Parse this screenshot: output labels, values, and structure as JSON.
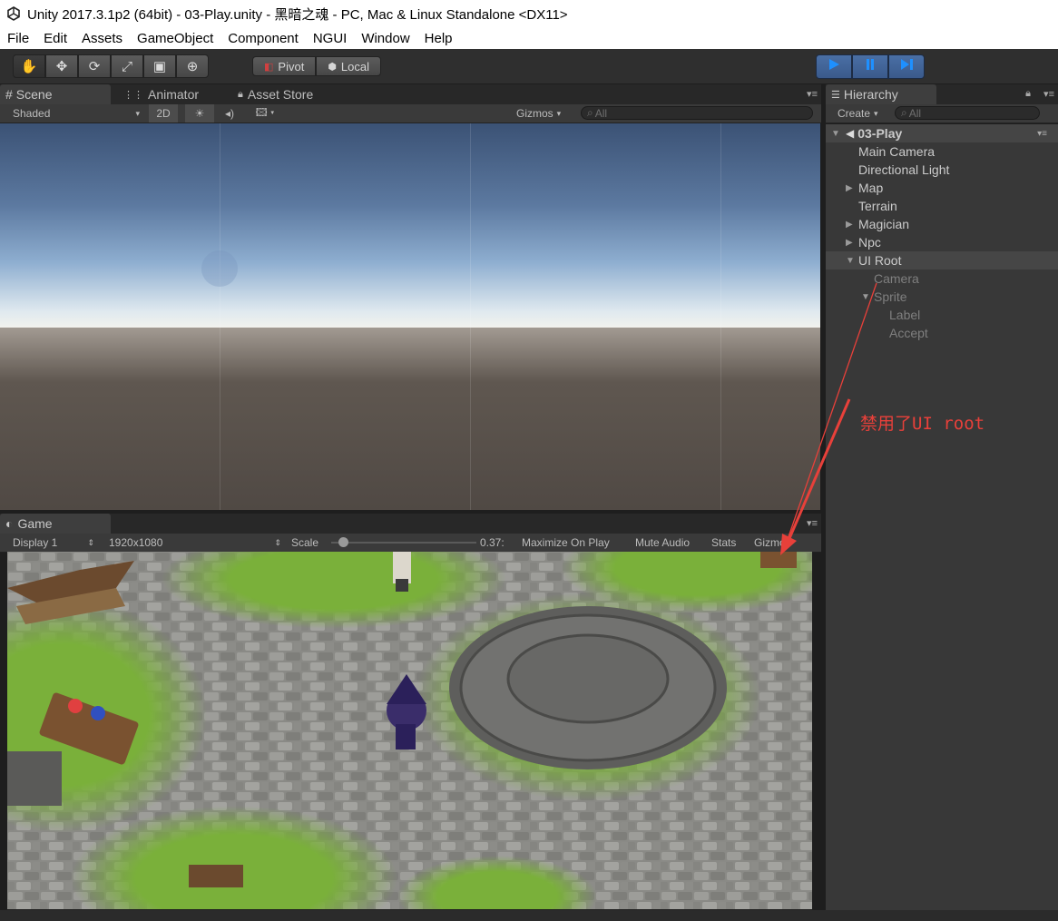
{
  "window": {
    "title": "Unity 2017.3.1p2 (64bit) - 03-Play.unity - 黑暗之魂 - PC, Mac & Linux Standalone <DX11>"
  },
  "menu": [
    "File",
    "Edit",
    "Assets",
    "GameObject",
    "Component",
    "NGUI",
    "Window",
    "Help"
  ],
  "toolbar": {
    "transform_tools": [
      "hand-icon",
      "move-icon",
      "rotate-icon",
      "scale-icon",
      "rect-icon",
      "transform-icon"
    ],
    "pivot_label": "Pivot",
    "local_label": "Local",
    "play_controls": [
      "play-icon",
      "pause-icon",
      "step-icon"
    ],
    "accent": "#1e90ff"
  },
  "scene_panel": {
    "tabs": [
      "Scene",
      "Animator",
      "Asset Store"
    ],
    "shading_mode": "Shaded",
    "mode_2d": "2D",
    "gizmos": "Gizmos",
    "search_placeholder": "All"
  },
  "game_panel": {
    "tab": "Game",
    "display": "Display 1",
    "resolution": "1920x1080",
    "scale_label": "Scale",
    "scale_value": "0.37:",
    "maximize": "Maximize On Play",
    "mute": "Mute Audio",
    "stats": "Stats",
    "gizmos": "Gizmos"
  },
  "hierarchy": {
    "tab": "Hierarchy",
    "create": "Create",
    "search_placeholder": "All",
    "scene_name": "03-Play",
    "items": [
      {
        "label": "Main Camera",
        "depth": 1,
        "arrow": "",
        "state": "normal"
      },
      {
        "label": "Directional Light",
        "depth": 1,
        "arrow": "",
        "state": "normal"
      },
      {
        "label": "Map",
        "depth": 1,
        "arrow": "collapsed",
        "state": "normal"
      },
      {
        "label": "Terrain",
        "depth": 1,
        "arrow": "",
        "state": "normal"
      },
      {
        "label": "Magician",
        "depth": 1,
        "arrow": "collapsed",
        "state": "normal"
      },
      {
        "label": "Npc",
        "depth": 1,
        "arrow": "collapsed",
        "state": "normal"
      },
      {
        "label": "UI Root",
        "depth": 1,
        "arrow": "expanded",
        "state": "selected"
      },
      {
        "label": "Camera",
        "depth": 2,
        "arrow": "",
        "state": "disabled"
      },
      {
        "label": "Sprite",
        "depth": 2,
        "arrow": "expanded",
        "state": "disabled"
      },
      {
        "label": "Label",
        "depth": 3,
        "arrow": "",
        "state": "disabled"
      },
      {
        "label": "Accept",
        "depth": 3,
        "arrow": "",
        "state": "disabled"
      }
    ]
  },
  "annotation": {
    "text": "禁用了UI root",
    "color": "#e8403a"
  }
}
